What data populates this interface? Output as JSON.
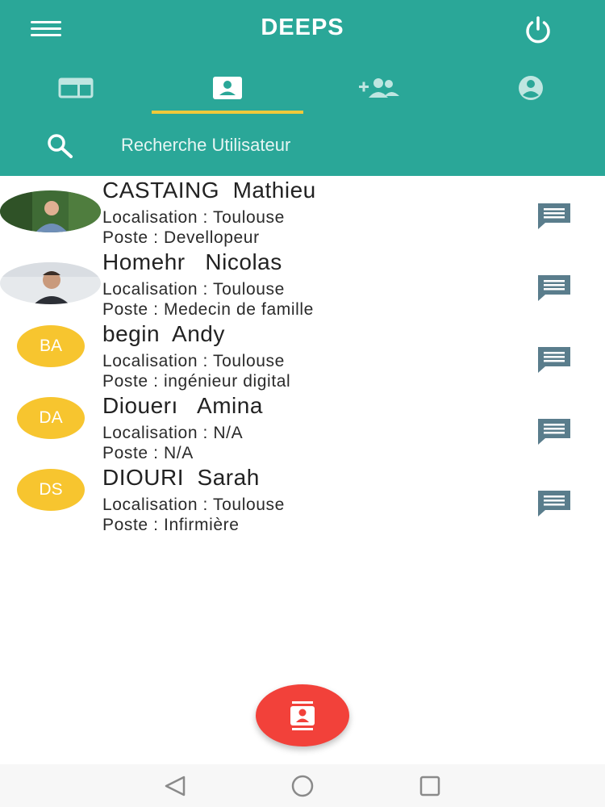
{
  "app": {
    "title": "DEEPS",
    "accent": "#2aa798",
    "tab_indicator_color": "#f0c93a",
    "fab_color": "#f2413a",
    "avatar_color": "#f7c52f"
  },
  "header": {
    "menu_icon": "hamburger-menu-icon",
    "power_icon": "power-icon"
  },
  "tabs": [
    {
      "icon": "dashboard-icon",
      "active": false
    },
    {
      "icon": "contact-card-icon",
      "active": true
    },
    {
      "icon": "add-group-icon",
      "active": false
    },
    {
      "icon": "account-circle-icon",
      "active": false
    }
  ],
  "search": {
    "placeholder": "Recherche Utilisateur",
    "icon": "search-icon"
  },
  "users": [
    {
      "name": "CASTAING  Mathieu",
      "localisation": "Localisation : Toulouse",
      "poste": "Poste : Devellopeur",
      "avatar": "photo",
      "initials": ""
    },
    {
      "name": "Homehr   Nicolas",
      "localisation": "Localisation : Toulouse",
      "poste": "Poste : Medecin de famille",
      "avatar": "photo",
      "initials": ""
    },
    {
      "name": "begin  Andy",
      "localisation": "Localisation : Toulouse",
      "poste": "Poste : ingénieur digital",
      "avatar": "initials",
      "initials": "BA"
    },
    {
      "name": "Diouerı   Amina",
      "localisation": "Localisation : N/A",
      "poste": "Poste : N/A",
      "avatar": "initials",
      "initials": "DA"
    },
    {
      "name": "DIOURI  Sarah",
      "localisation": "Localisation : Toulouse",
      "poste": "Poste : Infirmière",
      "avatar": "initials",
      "initials": "DS"
    }
  ],
  "fab": {
    "icon": "contacts-icon"
  },
  "navbar": {
    "back_icon": "back-triangle-icon",
    "home_icon": "home-circle-icon",
    "recents_icon": "recents-square-icon"
  }
}
